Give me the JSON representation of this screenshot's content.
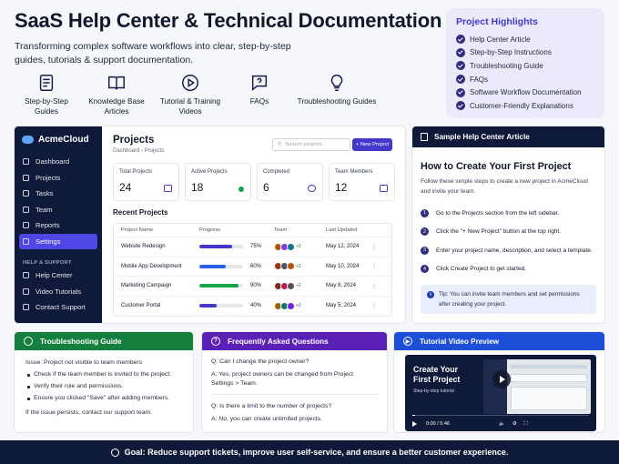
{
  "header": {
    "title": "SaaS Help Center & Technical Documentation",
    "subtitle": "Transforming complex software workflows into clear, step-by-step guides, tutorials & support documentation."
  },
  "categories": [
    {
      "label": "Step-by-Step Guides",
      "icon": "checklist-icon"
    },
    {
      "label": "Knowledge Base Articles",
      "icon": "book-icon"
    },
    {
      "label": "Tutorial & Training Videos",
      "icon": "play-icon"
    },
    {
      "label": "FAQs",
      "icon": "faq-chat-icon"
    },
    {
      "label": "Troubleshooting Guides",
      "icon": "lightbulb-icon"
    }
  ],
  "highlights": {
    "title": "Project Highlights",
    "items": [
      "Help Center Article",
      "Step-by-Step Instructions",
      "Troubleshooting Guide",
      "FAQs",
      "Software Workflow Documentation",
      "Customer-Friendly Explanations"
    ]
  },
  "app": {
    "brand": "AcmeCloud",
    "nav": [
      "Dashboard",
      "Projects",
      "Tasks",
      "Team",
      "Reports",
      "Settings"
    ],
    "active": "Settings",
    "help_heading": "HELP & SUPPORT",
    "help_nav": [
      "Help Center",
      "Video Tutorials",
      "Contact Support"
    ],
    "page_title": "Projects",
    "breadcrumb": [
      "Dashboard",
      "Projects"
    ],
    "search_placeholder": "Search projects...",
    "new_button": "+ New Project",
    "stats": [
      {
        "label": "Total Projects",
        "value": "24"
      },
      {
        "label": "Active Projects",
        "value": "18"
      },
      {
        "label": "Completed",
        "value": "6"
      },
      {
        "label": "Team Members",
        "value": "12"
      }
    ],
    "recent_title": "Recent Projects",
    "columns": [
      "Project Name",
      "Progress",
      "Team",
      "Last Updated"
    ],
    "rows": [
      {
        "name": "Website Redesign",
        "progress": "75%",
        "pct": 75,
        "color": "#4338ca",
        "team": "+2",
        "date": "May 12, 2024"
      },
      {
        "name": "Mobile App Development",
        "progress": "60%",
        "pct": 60,
        "color": "#2563eb",
        "team": "+2",
        "date": "May 10, 2024"
      },
      {
        "name": "Marketing Campaign",
        "progress": "90%",
        "pct": 90,
        "color": "#16a34a",
        "team": "+2",
        "date": "May 8, 2024"
      },
      {
        "name": "Customer Portal",
        "progress": "40%",
        "pct": 40,
        "color": "#4338ca",
        "team": "+2",
        "date": "May 5, 2024"
      }
    ]
  },
  "article": {
    "header": "Sample Help Center Article",
    "title": "How to Create Your First Project",
    "desc": "Follow these simple steps to create a new project in AcmeCloud and invite your team.",
    "steps": [
      "Go to the Projects section from the left sidebar.",
      "Click the \"+ New Project\" button at the top right.",
      "Enter your project name, description, and select a template.",
      "Click Create Project to get started."
    ],
    "tip": "Tip: You can invite team members and set permissions after creating your project."
  },
  "troubleshooting": {
    "title": "Troubleshooting Guide",
    "issue": "Issue: Project not visible to team members",
    "items": [
      "Check if the team member is invited to the project.",
      "Verify their role and permissions.",
      "Ensure you clicked \"Save\" after adding members."
    ],
    "footer": "If the issue persists, contact our support team."
  },
  "faq": {
    "title": "Frequently Asked Questions",
    "q1": "Q: Can I change the project owner?",
    "a1": "A: Yes, project owners can be changed from Project Settings > Team.",
    "q2": "Q: Is there a limit to the number of projects?",
    "a2": "A: No, you can create unlimited projects."
  },
  "video": {
    "title": "Tutorial Video Preview",
    "video_title": "Create Your First Project",
    "video_sub": "Step-by-step tutorial",
    "time": "0:00 / 5:46"
  },
  "footer": "Goal: Reduce support tickets, improve user self-service, and ensure a better customer experience."
}
